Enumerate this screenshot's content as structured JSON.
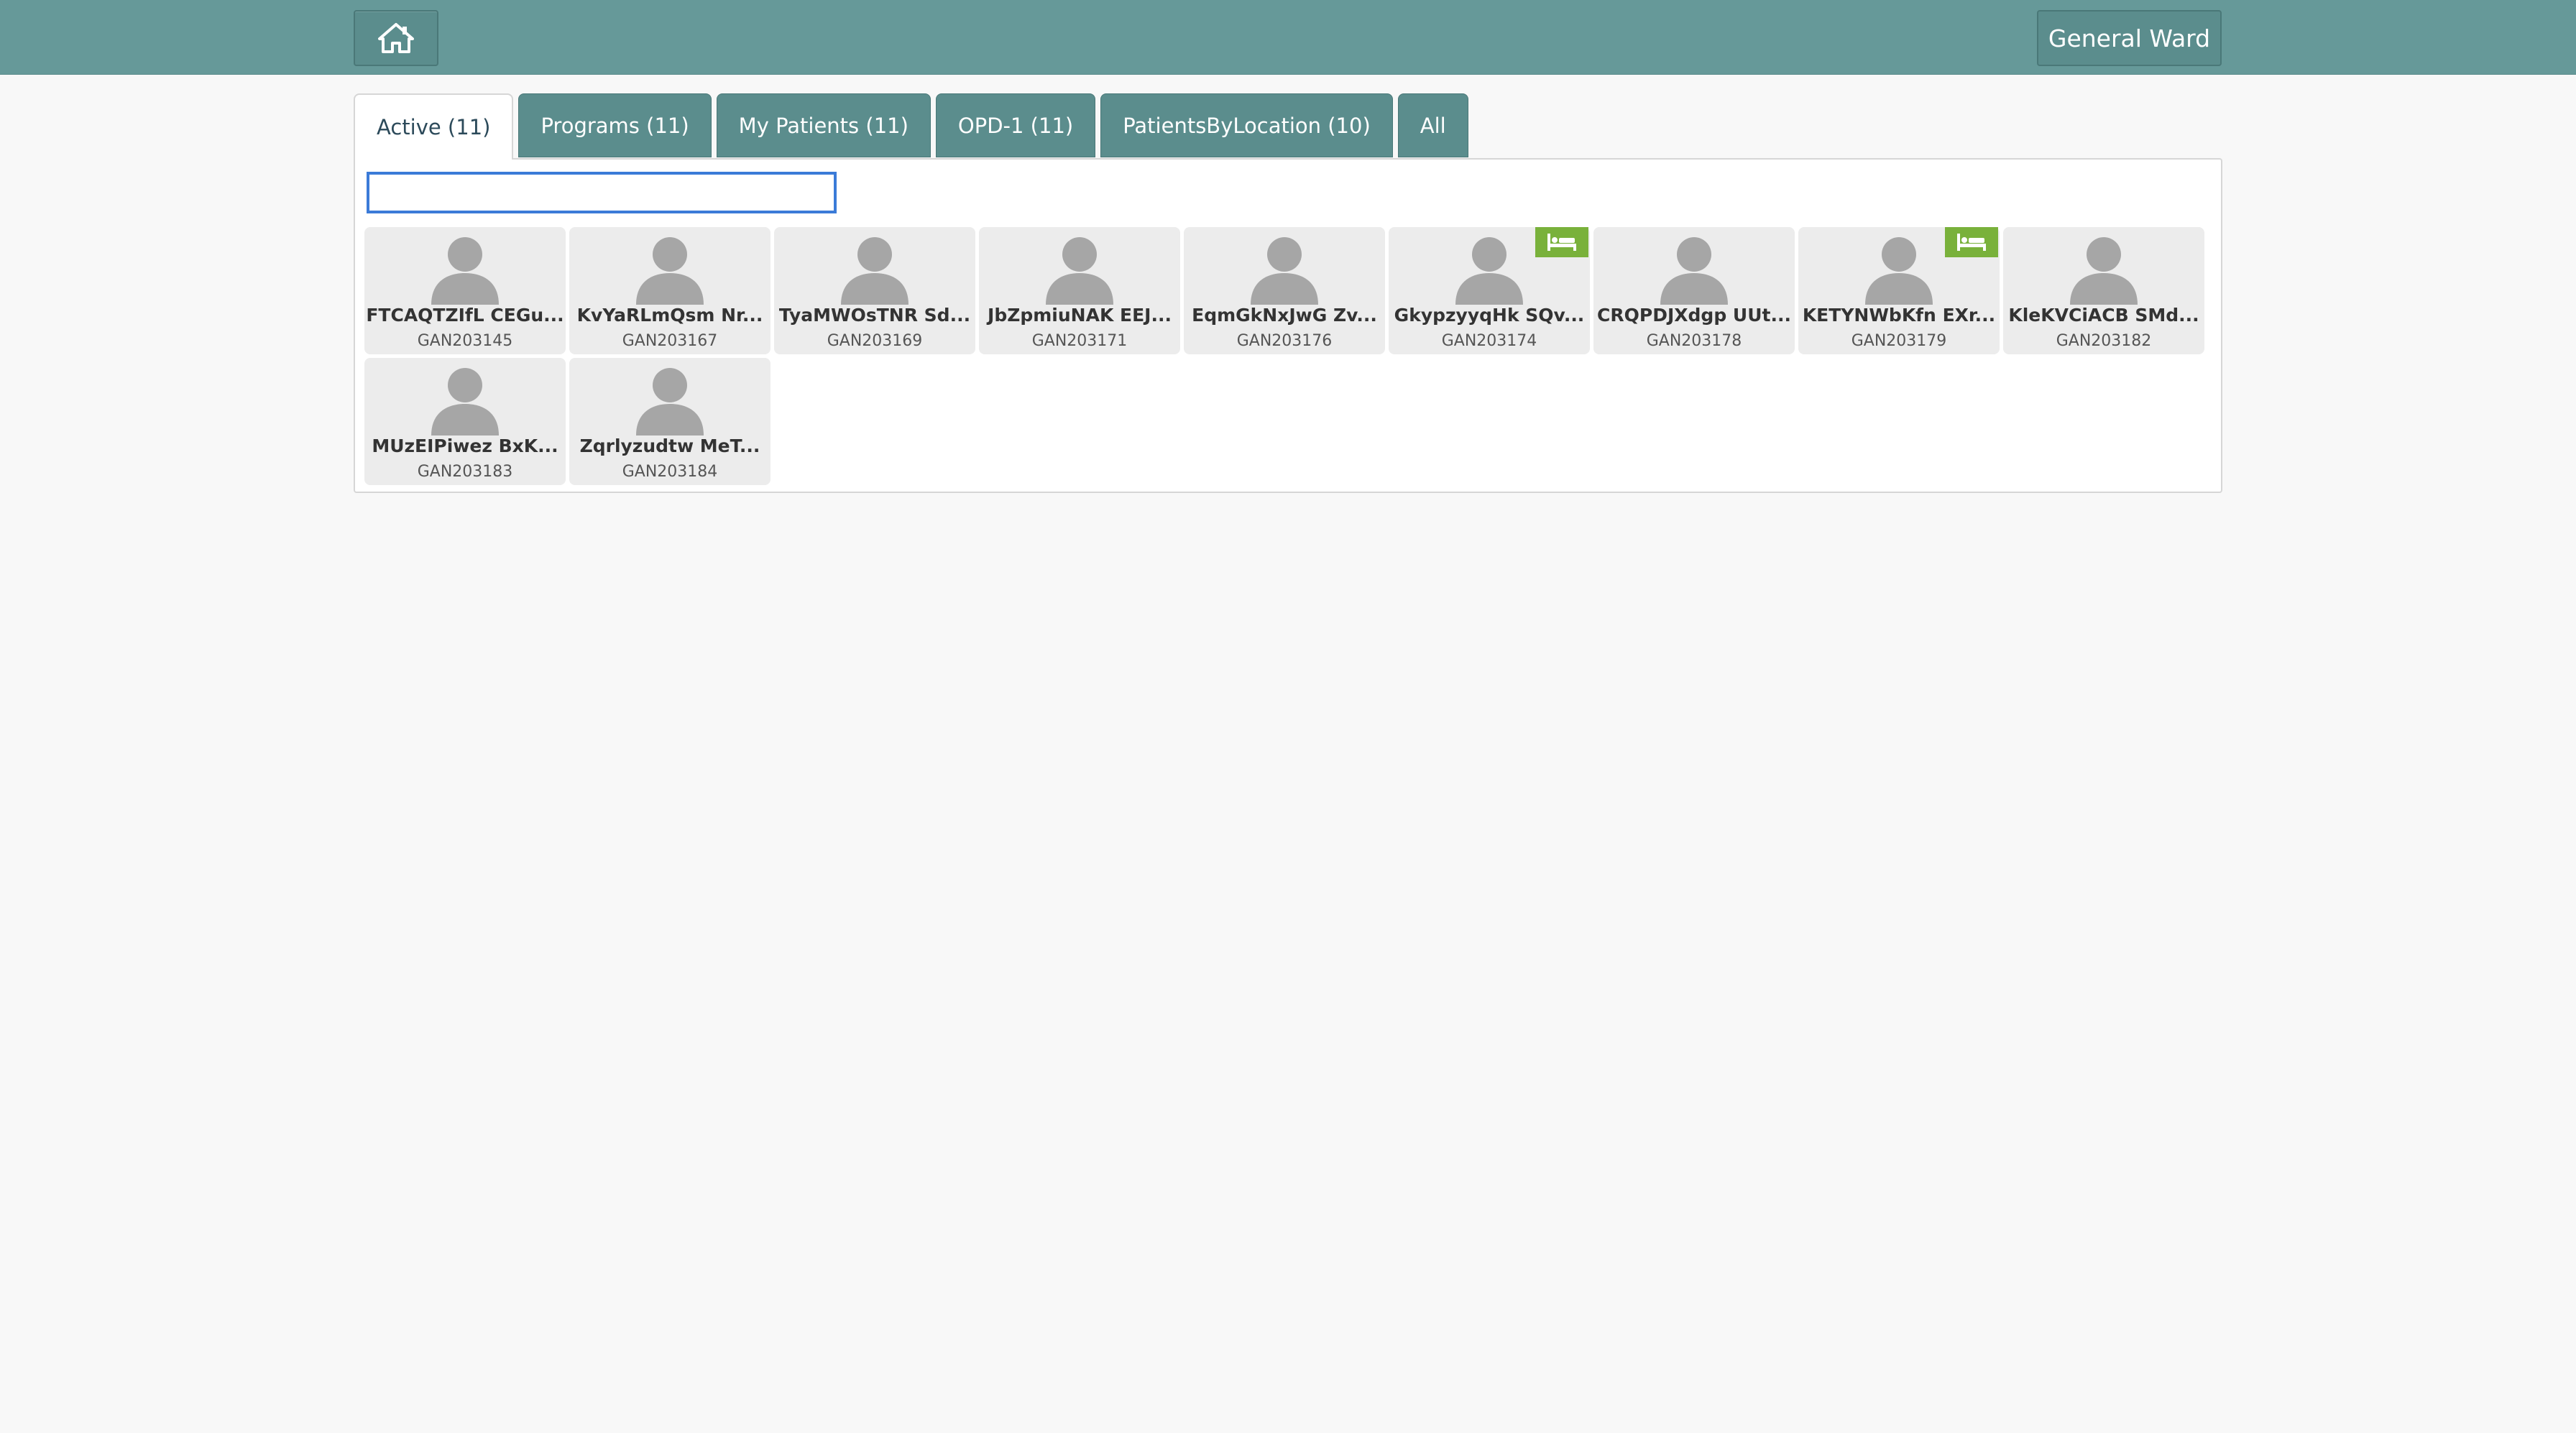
{
  "header": {
    "home_icon": "home-icon",
    "location": "General Ward"
  },
  "tabs": [
    {
      "label": "Active (11)",
      "active": true
    },
    {
      "label": "Programs (11)",
      "active": false
    },
    {
      "label": "My Patients (11)",
      "active": false
    },
    {
      "label": "OPD-1 (11)",
      "active": false
    },
    {
      "label": "PatientsByLocation (10)",
      "active": false
    },
    {
      "label": "All",
      "active": false
    }
  ],
  "search": {
    "value": "",
    "placeholder": ""
  },
  "patients": [
    {
      "name": "FTCAQTZIfL CEGu...",
      "id": "GAN203145",
      "bed": false
    },
    {
      "name": "KvYaRLmQsm Nr...",
      "id": "GAN203167",
      "bed": false
    },
    {
      "name": "TyaMWOsTNR Sd...",
      "id": "GAN203169",
      "bed": false
    },
    {
      "name": "JbZpmiuNAK EEJ...",
      "id": "GAN203171",
      "bed": false
    },
    {
      "name": "EqmGkNxJwG Zv...",
      "id": "GAN203176",
      "bed": false
    },
    {
      "name": "GkypzyyqHk SQv...",
      "id": "GAN203174",
      "bed": true
    },
    {
      "name": "CRQPDJXdgp UUt...",
      "id": "GAN203178",
      "bed": false
    },
    {
      "name": "KETYNWbKfn EXr...",
      "id": "GAN203179",
      "bed": true
    },
    {
      "name": "KleKVCiACB SMd...",
      "id": "GAN203182",
      "bed": false
    },
    {
      "name": "MUzEIPiwez BxK...",
      "id": "GAN203183",
      "bed": false
    },
    {
      "name": "Zqrlyzudtw MeT...",
      "id": "GAN203184",
      "bed": false
    }
  ],
  "colors": {
    "header_bg": "#669999",
    "tab_bg": "#5b8d8d",
    "search_focus": "#3b7bd8",
    "bed_badge": "#79b13b",
    "card_bg": "#ececec"
  }
}
